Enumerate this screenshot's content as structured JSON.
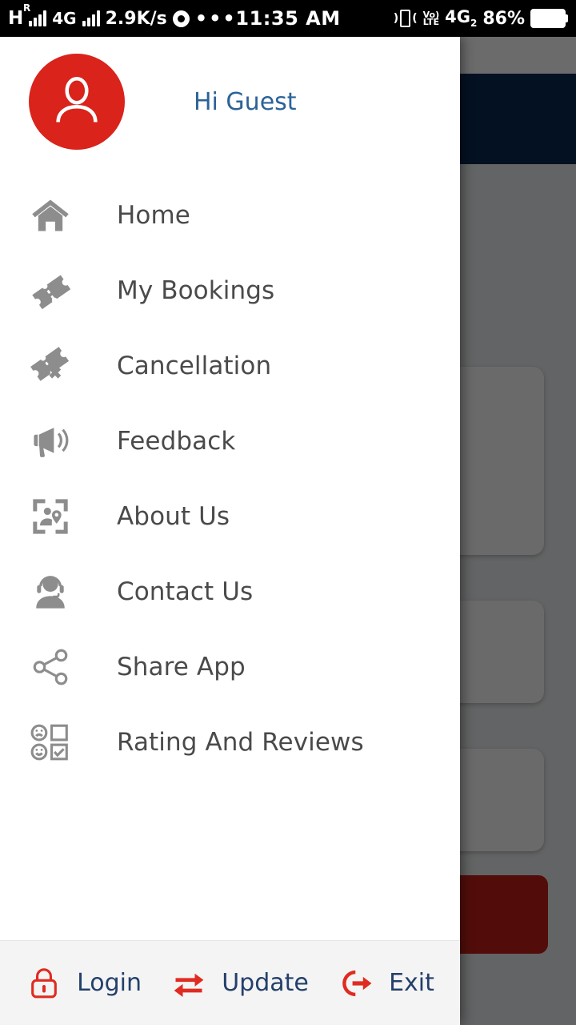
{
  "status_bar": {
    "network_type": "H",
    "roaming_badge": "R",
    "sim2_type": "4G",
    "data_speed": "2.9K/s",
    "browser_icon": "chrome-icon",
    "overflow": "•••",
    "time": "11:35 AM",
    "vibrate_icon": "vibrate-icon",
    "volte_top": "Vo)",
    "volte_bottom": "LTE",
    "signal_label": "4G",
    "signal_sub": "2",
    "battery_percent": "86%"
  },
  "drawer": {
    "avatar_icon": "user-avatar-icon",
    "greeting": "Hi Guest",
    "items": [
      {
        "label": "Home",
        "icon": "home-icon"
      },
      {
        "label": "My Bookings",
        "icon": "ticket-icon"
      },
      {
        "label": "Cancellation",
        "icon": "ticket-cancel-icon"
      },
      {
        "label": "Feedback",
        "icon": "megaphone-icon"
      },
      {
        "label": "About Us",
        "icon": "about-location-icon"
      },
      {
        "label": "Contact Us",
        "icon": "headset-support-icon"
      },
      {
        "label": "Share App",
        "icon": "share-nodes-icon"
      },
      {
        "label": "Rating And Reviews",
        "icon": "rating-checkbox-icon"
      }
    ],
    "footer": [
      {
        "label": "Login",
        "icon": "lock-icon"
      },
      {
        "label": "Update",
        "icon": "sync-arrows-icon"
      },
      {
        "label": "Exit",
        "icon": "logout-icon"
      }
    ]
  },
  "background": {
    "appbar_color": "#0b2a52",
    "primary_button_color": "#c4211a",
    "download_icon": "download-circle-icon"
  },
  "colors": {
    "accent_red": "#d9231b",
    "link_blue": "#2b6398",
    "footer_label_blue": "#24406b",
    "icon_grey": "#8d8d8d",
    "label_grey": "#4a4a4a"
  }
}
